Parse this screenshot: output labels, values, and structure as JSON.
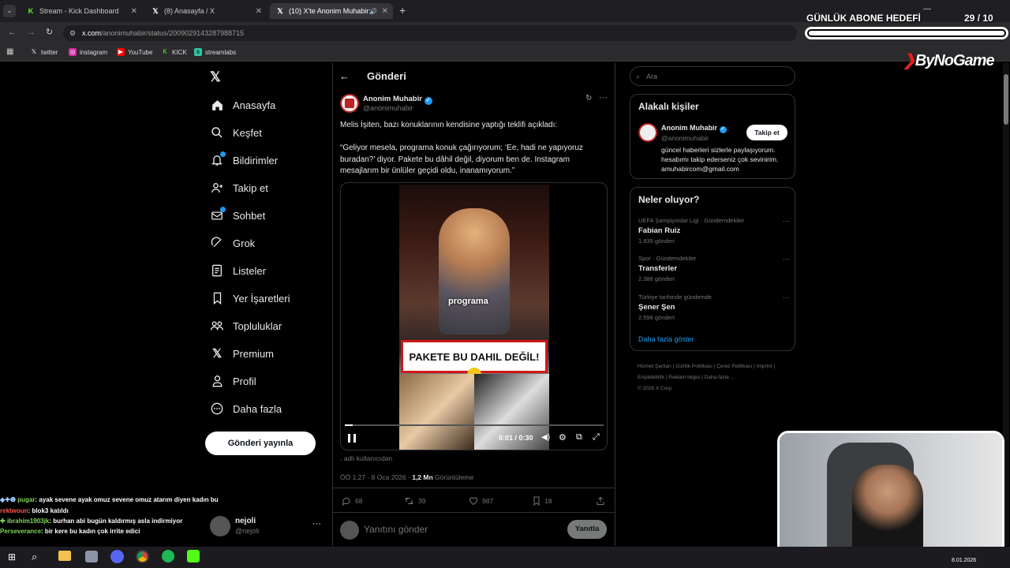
{
  "browser": {
    "tabs": [
      {
        "title": "Stream - Kick Dashboard",
        "icon": "kick-icon"
      },
      {
        "title": "(8) Anasayfa / X",
        "icon": "x-logo-icon"
      },
      {
        "title": "(10) X'te Anonim Muhabir:",
        "icon": "x-logo-icon"
      }
    ],
    "url_host": "x.com",
    "url_path": "/anonimuhabir/status/2009029143287988715",
    "bookmarks": [
      "twitter",
      "instagram",
      "YouTube",
      "KICK",
      "streamlabs"
    ]
  },
  "nav": {
    "items": [
      "Anasayfa",
      "Keşfet",
      "Bildirimler",
      "Takip et",
      "Sohbet",
      "Grok",
      "Listeler",
      "Yer İşaretleri",
      "Topluluklar",
      "Premium",
      "Profil",
      "Daha fazla"
    ],
    "post_button": "Gönderi yayınla",
    "account_name": "nejoli",
    "account_handle": "@nejoli"
  },
  "post": {
    "header": "Gönderi",
    "author_name": "Anonim Muhabir",
    "author_handle": "@anonimuhabir",
    "paragraph1": "Melis İşiten, bazı konuklarının kendisine yaptığı teklifi açıkladı:",
    "paragraph2": "“Geliyor mesela, programa konuk çağırıyorum; ‘Ee, hadi ne yapıyoruz buradan?’ diyor. Pakete bu dâhil değil, diyorum ben de. Instagram mesajlarım bir ünlüler geçidi oldu, inanamıyorum.”",
    "video_caption_small": "programa",
    "video_banner": "PAKETE BU DAHIL DEĞİL!",
    "video_time": "0:01 / 0:30",
    "video_progress": 0.03,
    "attribution": ". adlı kullanıcıdan",
    "meta_time": "ÖÖ 1:27 · 8 Oca 2026 ·",
    "views": "1,2 Mn",
    "views_label": "Görüntüleme",
    "replies": "68",
    "reposts": "39",
    "likes": "987",
    "bookmarks": "18",
    "reply_placeholder": "Yanıtını gönder",
    "reply_button": "Yanıtla"
  },
  "right": {
    "search_placeholder": "Ara",
    "related_title": "Alakalı kişiler",
    "related_name": "Anonim Muhabir",
    "related_handle": "@anonimuhabir",
    "related_bio": "güncel haberleri sizlerle paylaşıyorum. hesabımı takip ederseniz çok sevinirim. amuhabircom@gmail.com",
    "follow_button": "Takip et",
    "trends_title": "Neler oluyor?",
    "trends": [
      {
        "meta": "UEFA Şampiyonlar Ligi · Gündemdekiler",
        "title": "Fabian Ruiz",
        "count": "1.935 gönderi"
      },
      {
        "meta": "Spor · Gündemdekiler",
        "title": "Transferler",
        "count": "2.388 gönderi"
      },
      {
        "meta": "Türkiye tarihinde gündemde",
        "title": "Şener Şen",
        "count": "2.596 gönderi"
      }
    ],
    "show_more": "Daha fazla göster",
    "footer": [
      "Hizmet Şartları",
      "Gizlilik Politikası",
      "Çerez Politikası",
      "Imprint",
      "Erişilebilirlik",
      "Reklam bilgisi",
      "Daha fazla ...",
      "© 2026 X Corp."
    ]
  },
  "overlay": {
    "goal_label": "GÜNLÜK ABONE HEDEFİ",
    "goal_current": "29",
    "goal_target": "/ 10",
    "goal_fraction": 1.0,
    "brand": "ByNoGame"
  },
  "chat": [
    {
      "user": "pugar",
      "color": "#7fd65a",
      "msg": ": ayak sevene ayak omuz sevene omuz atarım diyen kadın bu"
    },
    {
      "user": "rektwoun",
      "color": "#ff5555",
      "msg": ": blok3 katıldı"
    },
    {
      "user": "ibrahim1903jk",
      "color": "#7fd65a",
      "msg": ": burhan abi bugün kaldırmış asla indirmiyor"
    },
    {
      "user": "Perseverance",
      "color": "#7fd65a",
      "msg": ": bir kere bu kadın çok irrite edici"
    }
  ],
  "taskbar": {
    "date": "8.01.2026"
  }
}
